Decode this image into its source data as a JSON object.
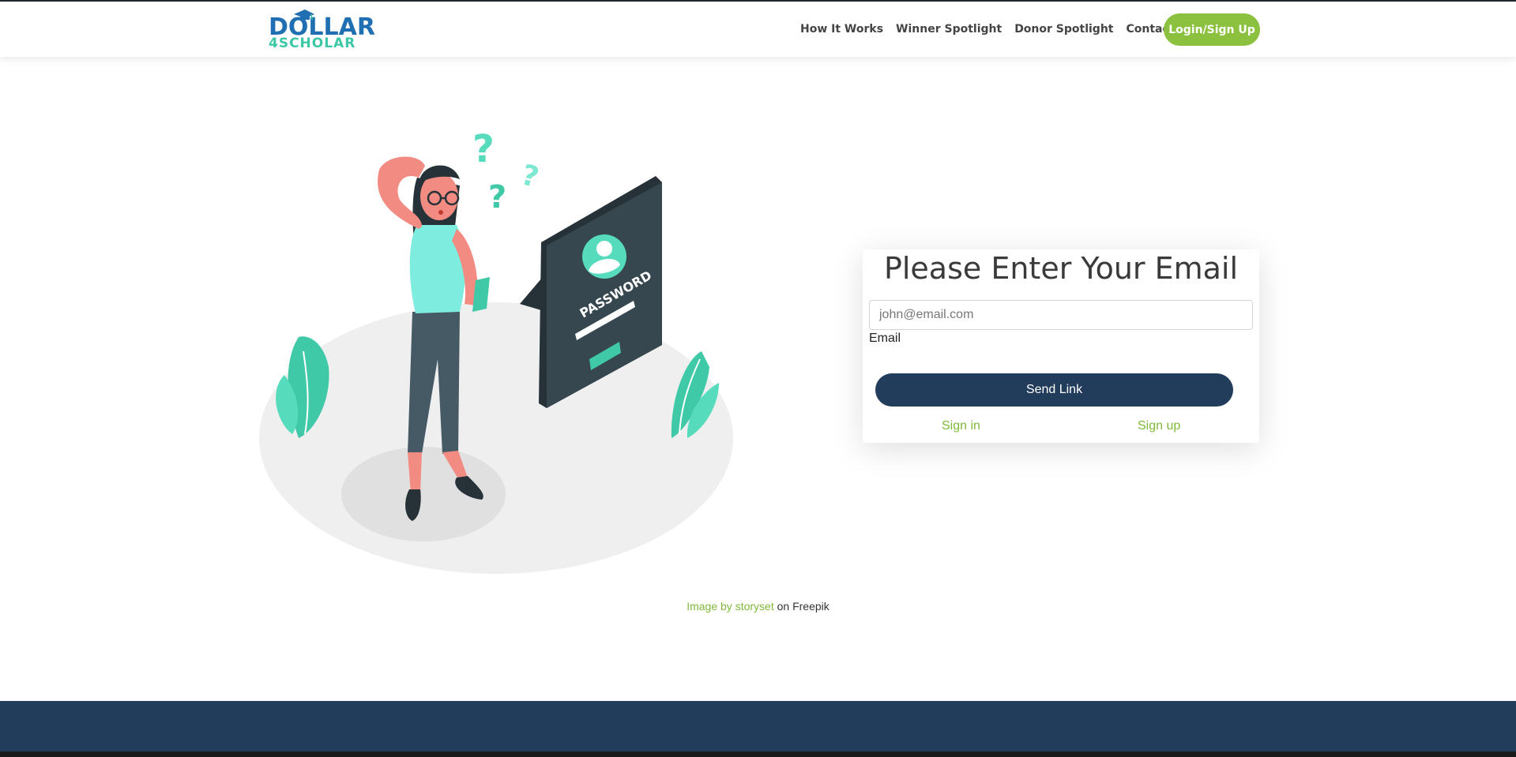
{
  "brand": {
    "logo_line1": "DOLLAR",
    "logo_line2": "4SCHOLAR",
    "primary_color": "#1f6fb2",
    "secondary_color": "#3cc8a6"
  },
  "nav": {
    "items": [
      {
        "label": "How It Works"
      },
      {
        "label": "Winner Spotlight"
      },
      {
        "label": "Donor Spotlight"
      },
      {
        "label": "Contact Us"
      }
    ],
    "login_label": "Login/Sign Up",
    "accent_color": "#8cc03f"
  },
  "illustration": {
    "password_text": "PASSWORD"
  },
  "form": {
    "title": "Please Enter Your Email",
    "email_placeholder": "john@email.com",
    "email_label": "Email",
    "submit_label": "Send Link",
    "sign_in_label": "Sign in",
    "sign_up_label": "Sign up",
    "button_color": "#223d5c"
  },
  "credit": {
    "link_text": "Image by storyset",
    "suffix": " on Freepik"
  },
  "footer": {
    "color": "#223d5c"
  }
}
